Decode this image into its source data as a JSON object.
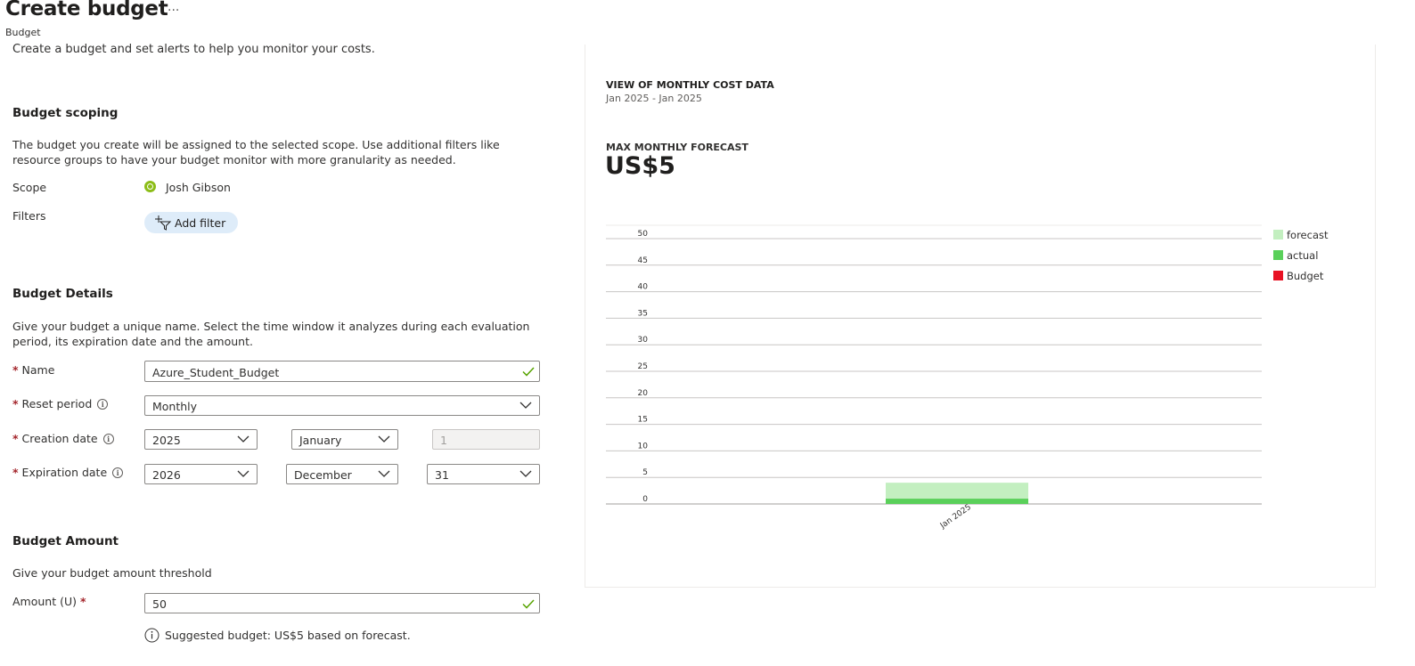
{
  "header": {
    "title": "Create budget",
    "more_label": "···",
    "breadcrumb": "Budget"
  },
  "intro": "Create a budget and set alerts to help you monitor your costs.",
  "scoping": {
    "heading": "Budget scoping",
    "description": "The budget you create will be assigned to the selected scope. Use additional filters like resource groups to have your budget monitor with more granularity as needed.",
    "scope_label": "Scope",
    "scope_value": "Josh Gibson",
    "scope_icon": "subscription-icon",
    "filters_label": "Filters",
    "add_filter_label": "Add filter",
    "add_filter_icon": "add-filter-icon"
  },
  "details": {
    "heading": "Budget Details",
    "description": "Give your budget a unique name. Select the time window it analyzes during each evaluation period, its expiration date and the amount.",
    "required_mark": "*",
    "name_label": "Name",
    "name_value": "Azure_Student_Budget",
    "reset_label": "Reset period",
    "reset_value": "Monthly",
    "creation_label": "Creation date",
    "creation_year": "2025",
    "creation_month": "January",
    "creation_day": "1",
    "expiration_label": "Expiration date",
    "expiration_year": "2026",
    "expiration_month": "December",
    "expiration_day": "31"
  },
  "amount": {
    "heading": "Budget Amount",
    "description": "Give your budget amount threshold",
    "amount_label": "Amount (U)",
    "required_mark": "*",
    "amount_value": "50",
    "suggestion": "Suggested budget: US$5 based on forecast."
  },
  "chart_panel": {
    "view_title": "VIEW OF MONTHLY COST DATA",
    "view_range": "Jan 2025 - Jan 2025",
    "forecast_title": "MAX MONTHLY FORECAST",
    "forecast_value": "US$5"
  },
  "colors": {
    "forecast": "#c3efc0",
    "actual": "#5ad05a",
    "budget": "#e81123",
    "accent": "#0078d4",
    "check": "#57a300"
  },
  "chart_data": {
    "type": "bar",
    "categories": [
      "Jan 2025"
    ],
    "series": [
      {
        "name": "actual",
        "values": [
          1
        ]
      },
      {
        "name": "forecast",
        "values": [
          3
        ]
      }
    ],
    "stacked": true,
    "yticks": [
      0,
      5,
      10,
      15,
      20,
      25,
      30,
      35,
      40,
      45,
      50
    ],
    "ylim": [
      0,
      50
    ],
    "legend": [
      "forecast",
      "actual",
      "Budget"
    ],
    "legend_position": "right",
    "grid": true
  }
}
